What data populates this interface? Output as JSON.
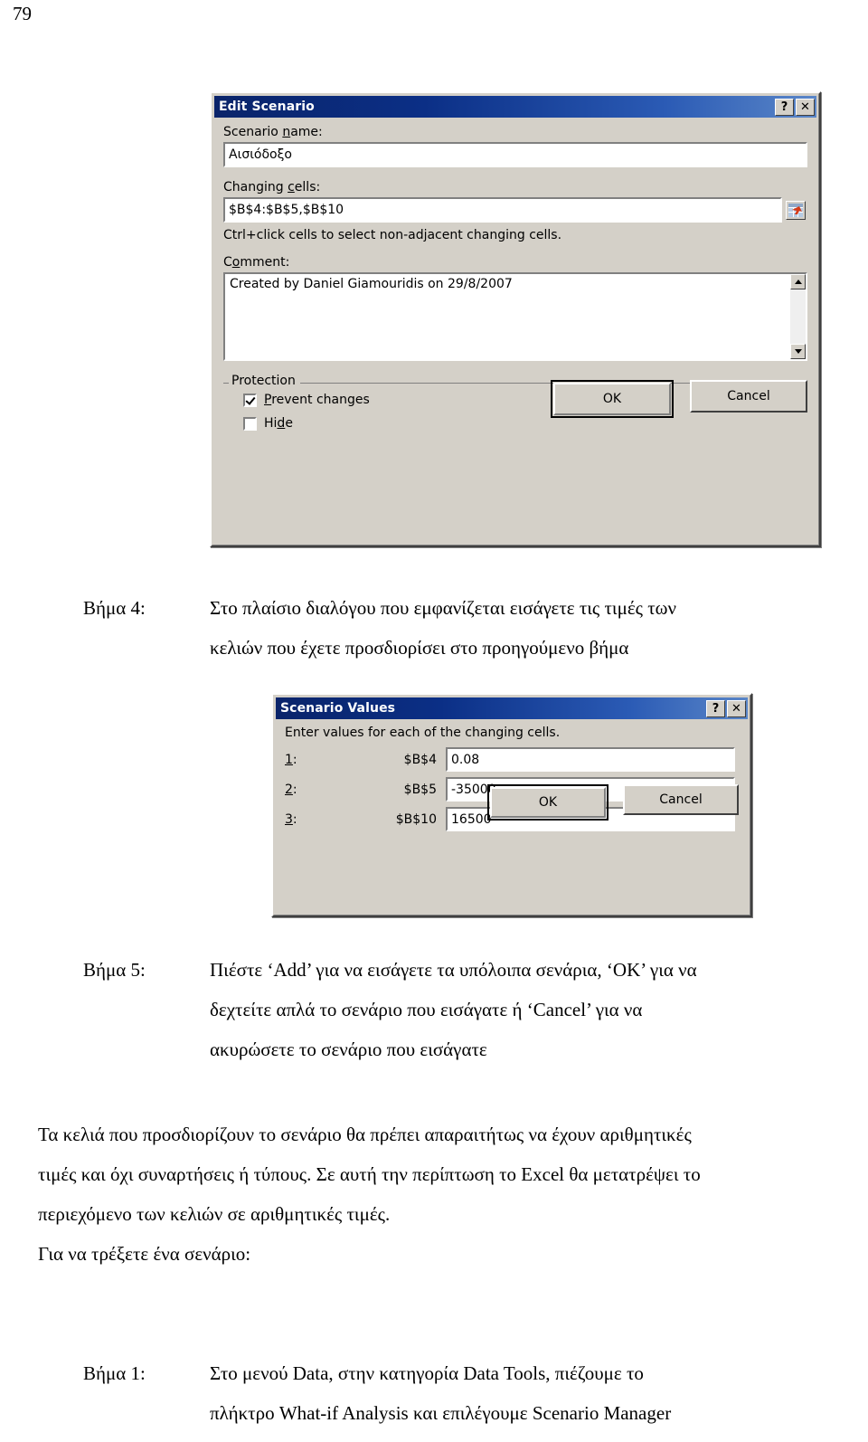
{
  "page": {
    "number": "79"
  },
  "edit_scenario_dialog": {
    "title": "Edit Scenario",
    "help_button": "?",
    "close_button": "✕",
    "scenario_name_label": "Scenario name:",
    "scenario_name_value": "Αισιόδοξο",
    "changing_cells_label": "Changing cells:",
    "changing_cells_value": "$B$4:$B$5,$B$10",
    "changing_cells_hint": "Ctrl+click cells to select non-adjacent changing cells.",
    "comment_label": "Comment:",
    "comment_value": "Created by Daniel Giamouridis on 29/8/2007",
    "protection_group_label": "Protection",
    "prevent_changes_label": "Prevent changes",
    "prevent_changes_checked": true,
    "hide_label": "Hide",
    "hide_checked": false,
    "ok_button": "OK",
    "cancel_button": "Cancel"
  },
  "scenario_values_dialog": {
    "title": "Scenario Values",
    "help_button": "?",
    "close_button": "✕",
    "instruction": "Enter values for each of the changing cells.",
    "rows": [
      {
        "index": "1:",
        "cell": "$B$4",
        "value": "0.08"
      },
      {
        "index": "2:",
        "cell": "$B$5",
        "value": "-35000"
      },
      {
        "index": "3:",
        "cell": "$B$10",
        "value": "16500"
      }
    ],
    "ok_button": "OK",
    "cancel_button": "Cancel"
  },
  "body": {
    "step4_label": "Βήμα 4:",
    "step4_line1": "Στο πλαίσιο διαλόγου που εμφανίζεται εισάγετε τις τιμές των",
    "step4_line2": "κελιών που έχετε προσδιορίσει στο προηγούμενο βήμα",
    "step5_label": "Βήμα 5:",
    "step5_line1": "Πιέστε ‘Add’ για να εισάγετε τα υπόλοιπα σενάρια, ‘OK’ για να",
    "step5_line2": "δεχτείτε απλά το σενάριο που εισάγατε ή ‘Cancel’ για να",
    "step5_line3": "ακυρώσετε το σενάριο που εισάγατε",
    "para1_line1": "Τα κελιά που προσδιορίζουν το σενάριο θα πρέπει απαραιτήτως να έχουν αριθμητικές",
    "para1_line2": "τιμές και όχι συναρτήσεις ή τύπους.  Σε αυτή την περίπτωση το Excel θα μετατρέψει το",
    "para1_line3": "περιεχόμενο των κελιών σε αριθμητικές τιμές.",
    "para2": "Για να τρέξετε ένα σενάριο:",
    "step1_label": "Βήμα 1:",
    "step1_line1": "Στο μενού Data, στην κατηγορία Data Tools, πιέζουμε το",
    "step1_line2": "πλήκτρο What-if Analysis και επιλέγουμε Scenario Manager"
  }
}
